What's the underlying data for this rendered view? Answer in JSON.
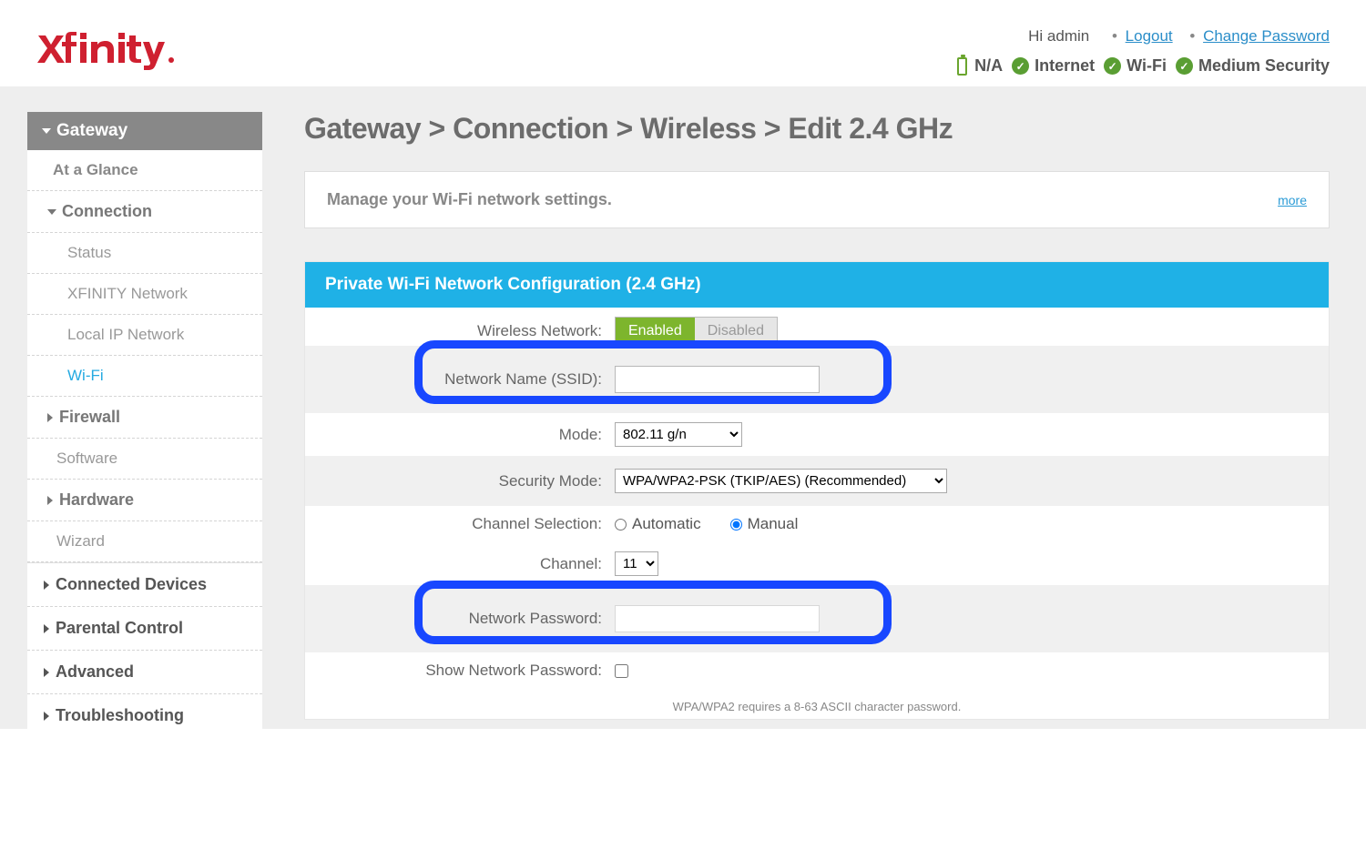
{
  "header": {
    "greeting": "Hi admin",
    "logout": "Logout",
    "change_password": "Change Password",
    "battery": "N/A",
    "internet": "Internet",
    "wifi": "Wi-Fi",
    "security": "Medium Security"
  },
  "sidebar": {
    "gateway": "Gateway",
    "at_a_glance": "At a Glance",
    "connection": "Connection",
    "status": "Status",
    "xfinity_network": "XFINITY Network",
    "local_ip": "Local IP Network",
    "wifi": "Wi-Fi",
    "firewall": "Firewall",
    "software": "Software",
    "hardware": "Hardware",
    "wizard": "Wizard",
    "connected_devices": "Connected Devices",
    "parental_control": "Parental Control",
    "advanced": "Advanced",
    "troubleshooting": "Troubleshooting"
  },
  "main": {
    "title": "Gateway > Connection > Wireless > Edit 2.4 GHz",
    "info_desc": "Manage your Wi-Fi network settings.",
    "info_more": "more",
    "panel_title": "Private Wi-Fi Network Configuration (2.4 GHz)",
    "labels": {
      "wireless_network": "Wireless Network:",
      "ssid": "Network Name (SSID):",
      "mode": "Mode:",
      "security_mode": "Security Mode:",
      "channel_selection": "Channel Selection:",
      "channel": "Channel:",
      "password": "Network Password:",
      "show_password": "Show Network Password:"
    },
    "toggle": {
      "enabled": "Enabled",
      "disabled": "Disabled"
    },
    "mode_value": "802.11 g/n",
    "security_value": "WPA/WPA2-PSK (TKIP/AES) (Recommended)",
    "channel_auto": "Automatic",
    "channel_manual": "Manual",
    "channel_value": "11",
    "hint": "WPA/WPA2 requires a 8-63 ASCII character password."
  }
}
